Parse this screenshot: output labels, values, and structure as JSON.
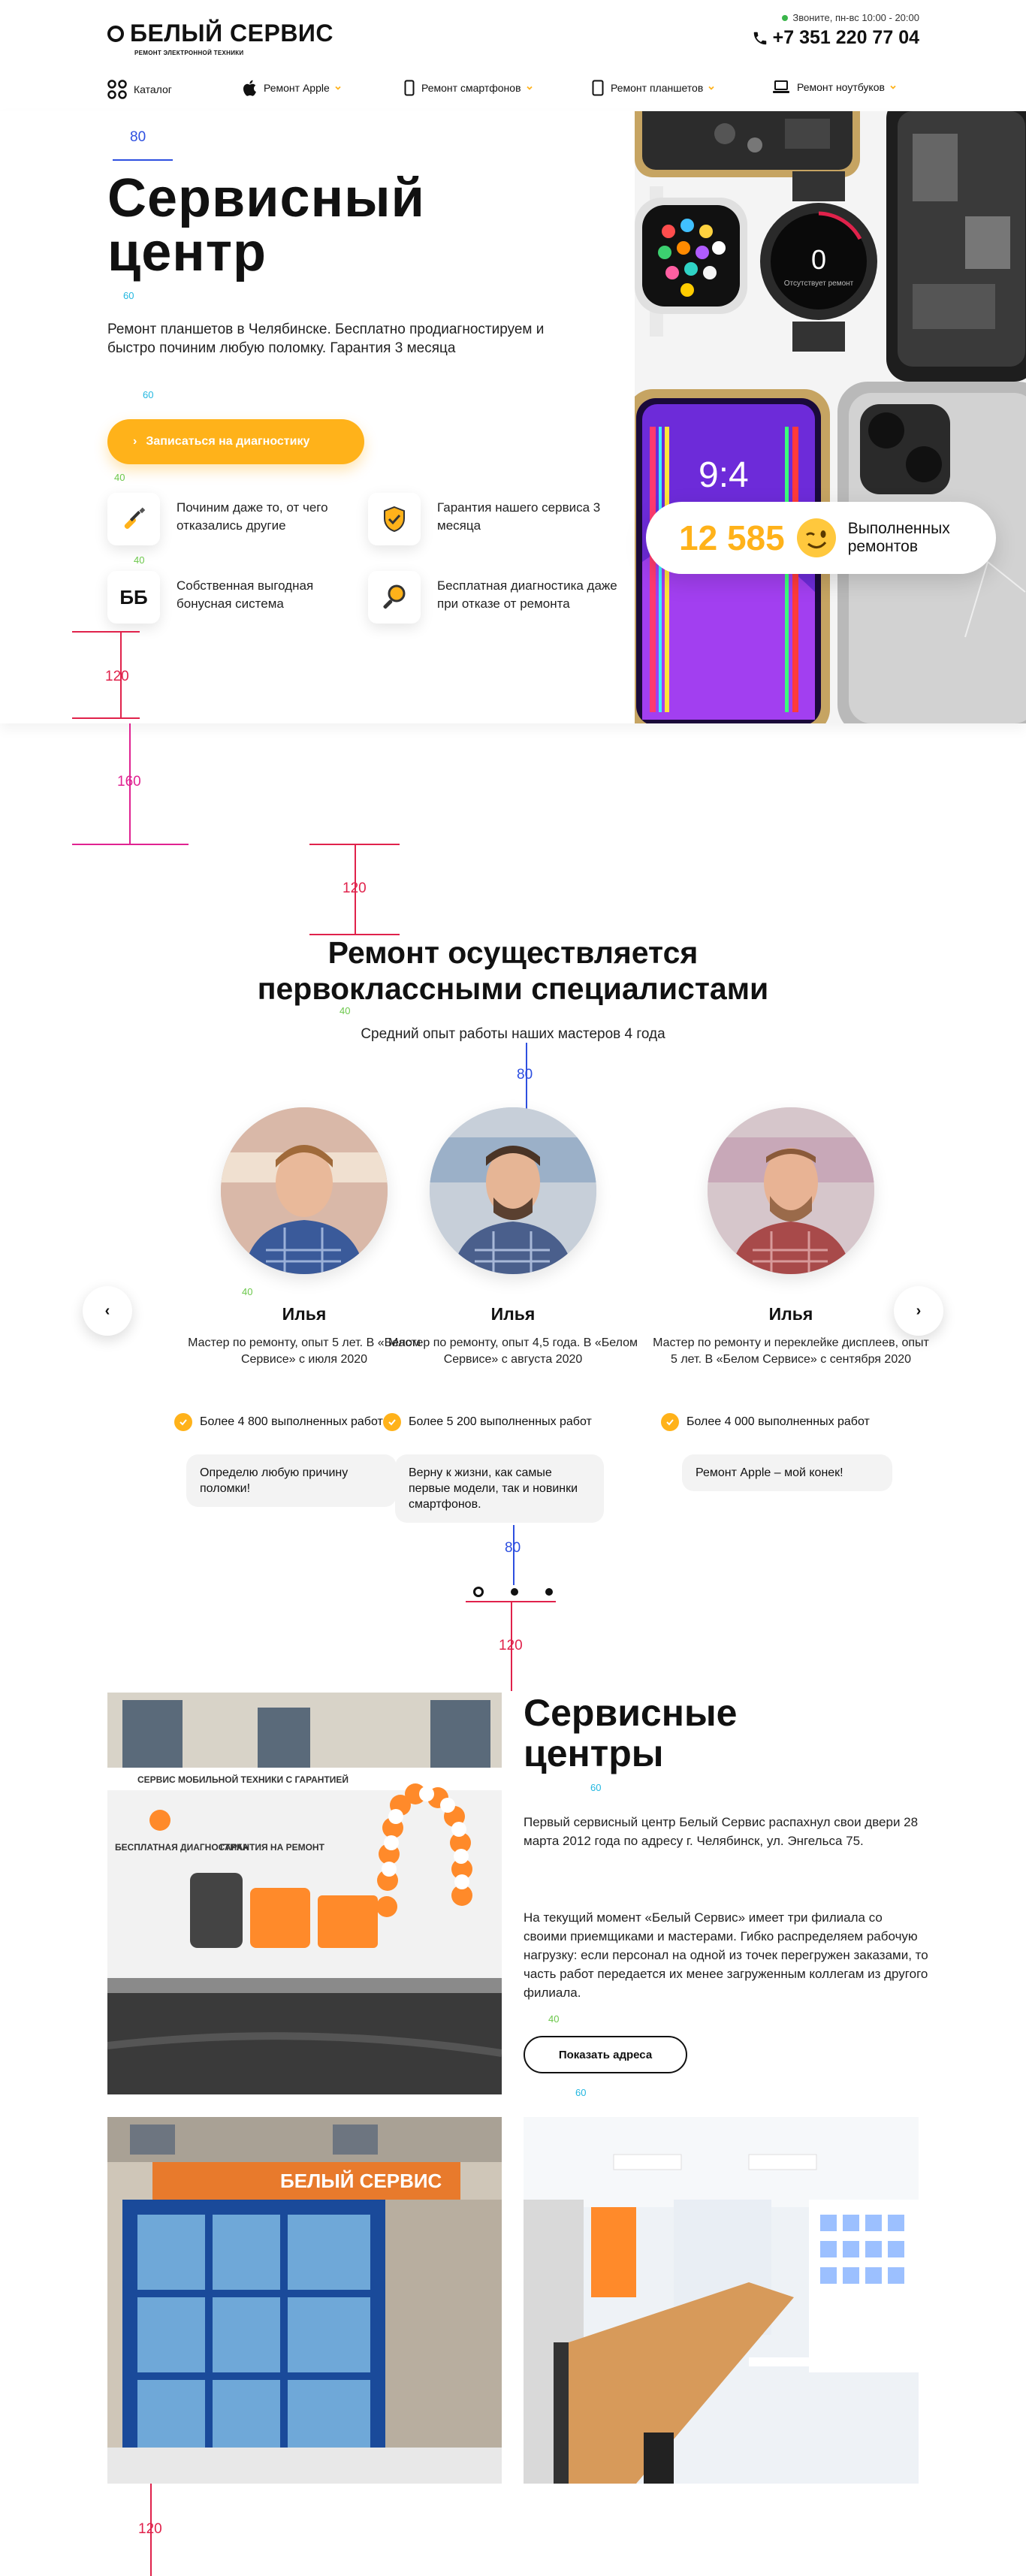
{
  "header": {
    "logo_text": "БЕЛЫЙ СЕРВИС",
    "logo_sub": "РЕМОНТ ЭЛЕКТРОННОЙ ТЕХНИКИ",
    "hours": "Звоните, пн-вс 10:00 - 20:00",
    "phone": "+7 351 220 77 04"
  },
  "nav": {
    "items": [
      {
        "label": "Каталог",
        "icon": "grid-icon"
      },
      {
        "label": "Ремонт Apple",
        "icon": "apple-icon"
      },
      {
        "label": "Ремонт смартфонов",
        "icon": "smartphone-icon"
      },
      {
        "label": "Ремонт планшетов",
        "icon": "tablet-icon"
      },
      {
        "label": "Ремонт ноутбуков",
        "icon": "laptop-icon"
      }
    ]
  },
  "hero": {
    "title": "Сервисный центр",
    "description": "Ремонт планшетов в Челябинске. Бесплатно продиагностируем и быстро починим любую поломку. Гарантия 3 месяца",
    "cta": "Записаться на диагностику",
    "features": [
      {
        "text": "Починим даже то, от чего отказались другие",
        "icon": "screwdriver-icon"
      },
      {
        "text": "Гарантия нашего сервиса 3 месяца",
        "icon": "shield-check-icon"
      },
      {
        "text": "Собственная выгодная бонусная система",
        "icon": "bonus-icon",
        "badge": "ББ"
      },
      {
        "text": "Бесплатная диагностика даже при отказе от ремонта",
        "icon": "magnifier-icon"
      }
    ],
    "counter_value": "12 585",
    "counter_label": "Выполненных ремонтов",
    "watch_screen": {
      "big": "0",
      "small": "Отсутствует ремонт"
    },
    "phone_time": "9:4"
  },
  "annotations": {
    "s80a": "80",
    "s60a": "60",
    "s60b": "60",
    "s40a": "40",
    "s40b": "40",
    "s120a": "120",
    "s160": "160",
    "s120b": "120",
    "s40c": "40",
    "s80b": "80",
    "s40d": "40",
    "s80c": "80",
    "s120c": "120",
    "s60c": "60",
    "s40e": "40",
    "s60d": "60",
    "s120d": "120"
  },
  "specialists": {
    "title_line1": "Ремонт осуществляется",
    "title_line2": "первоклассными специалистами",
    "subtitle": "Средний опыт работы наших мастеров 4 года",
    "masters": [
      {
        "name": "Илья",
        "info": "Мастер по ремонту, опыт 5 лет. В «Белом Сервисе» с июля 2020",
        "works": "Более 4 800 выполненных работ",
        "quote": "Определю любую причину поломки!"
      },
      {
        "name": "Илья",
        "info": "Мастер по ремонту, опыт 4,5 года. В «Белом Сервисе» с августа 2020",
        "works": "Более 5 200 выполненных работ",
        "quote": "Верну к жизни, как самые первые модели, так и новинки смартфонов."
      },
      {
        "name": "Илья",
        "info": "Мастер по ремонту и переклейке дисплеев, опыт 5 лет. В «Белом Сервисе» с сентября 2020",
        "works": "Более 4 000 выполненных работ",
        "quote": "Ремонт Apple – мой конек!"
      }
    ],
    "prev": "‹",
    "next": "›"
  },
  "service_centers": {
    "title": "Сервисные центры",
    "para1": "Первый сервисный центр Белый Сервис распахнул свои двери 28 марта 2012 года по адресу г. Челябинск, ул. Энгельса 75.",
    "para2": "На текущий момент «Белый Сервис» имеет три филиала со своими приемщиками и мастерами. Гибко распределяем рабочую нагрузку: если персонал на одной из точек перегружен заказами, то часть работ передается их менее загруженным коллегам из другого филиала.",
    "button": "Показать адреса",
    "storefront_sign": "БЕЛЫЙ СЕРВИС",
    "banner_text": "СЕРВИС МОБИЛЬНОЙ ТЕХНИКИ С ГАРАНТИЕЙ",
    "banner_left": "БЕСПЛАТНАЯ ДИАГНОСТИКА",
    "banner_right": "ГАРАНТИЯ НА РЕМОНТ"
  },
  "colors": {
    "accent": "#ffb21a",
    "cyan": "#22b7e0",
    "blue": "#2d4fe0",
    "magenta": "#e02291",
    "red": "#e0224b",
    "green": "#6bc74a"
  }
}
